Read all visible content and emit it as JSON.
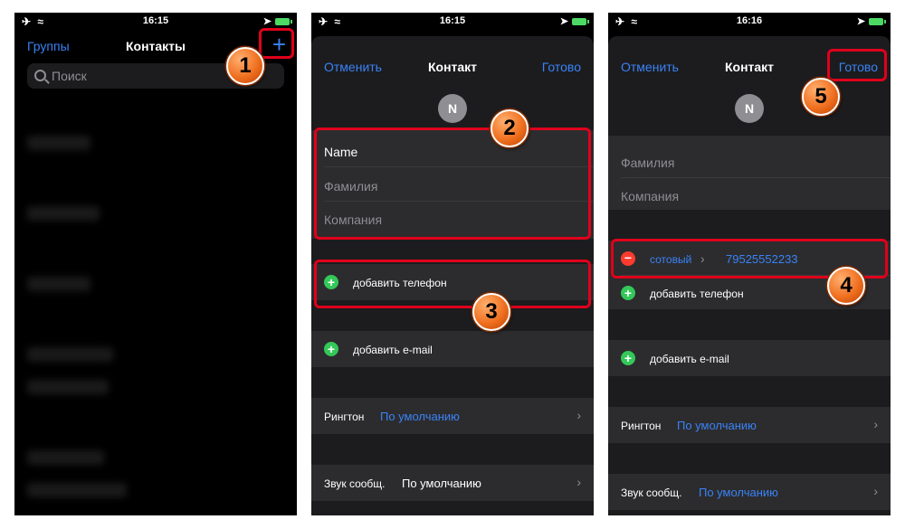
{
  "status": {
    "time1": "16:15",
    "time2": "16:15",
    "time3": "16:16"
  },
  "screen1": {
    "groups": "Группы",
    "title": "Контакты",
    "add": "+",
    "search_placeholder": "Поиск"
  },
  "screen2": {
    "cancel": "Отменить",
    "title": "Контакт",
    "done": "Готово",
    "avatar": "N",
    "name": "Name",
    "surname": "Фамилия",
    "company": "Компания",
    "add_phone": "добавить телефон",
    "add_email": "добавить e-mail",
    "ringtone_label": "Рингтон",
    "ringtone_value": "По умолчанию",
    "sound_label": "Звук сообщ.",
    "sound_value": "По умолчанию"
  },
  "screen3": {
    "cancel": "Отменить",
    "title": "Контакт",
    "done": "Готово",
    "avatar": "N",
    "surname": "Фамилия",
    "company": "Компания",
    "phone_type": "сотовый",
    "phone_number": "79525552233",
    "add_phone": "добавить телефон",
    "add_email": "добавить e-mail",
    "ringtone_label": "Рингтон",
    "ringtone_value": "По умолчанию",
    "sound_label": "Звук сообщ.",
    "sound_value": "По умолчанию"
  },
  "steps": [
    "1",
    "2",
    "3",
    "4",
    "5"
  ],
  "colors": {
    "accent": "#3a82f6",
    "highlight": "#e0001b",
    "badge": "#f07020"
  }
}
